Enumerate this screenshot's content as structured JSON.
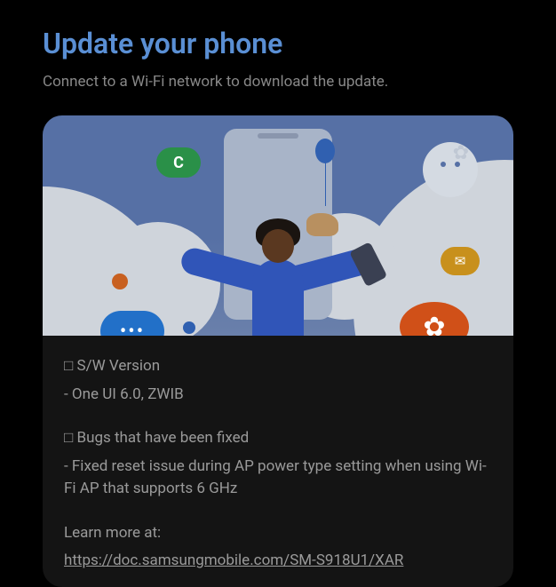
{
  "header": {
    "title": "Update your phone",
    "subtitle": "Connect to a Wi-Fi network to download the update."
  },
  "illustration": {
    "phone_pill": "C",
    "chat_pill": "•••",
    "mail_pill": "✉",
    "flower_pill": "✿",
    "gear_icon": "✿"
  },
  "body": {
    "section1_header": "□ S/W Version",
    "section1_item": "- One UI 6.0, ZWIB",
    "section2_header": "□ Bugs that have been fixed",
    "section2_item": "- Fixed reset issue during AP power type setting when using Wi-Fi AP that supports 6 GHz",
    "learn_more_label": "Learn more at:",
    "learn_more_url": "https://doc.samsungmobile.com/SM-S918U1/XAR"
  }
}
